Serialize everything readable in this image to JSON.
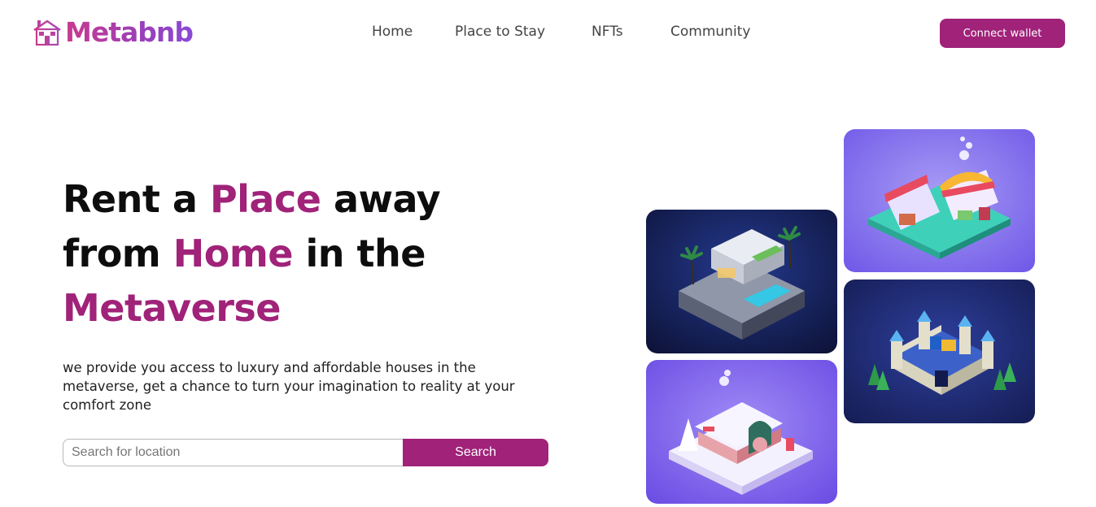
{
  "brand": {
    "name": "Metabnb",
    "icon": "house-icon"
  },
  "nav": {
    "links": [
      {
        "label": "Home"
      },
      {
        "label": "Place to Stay"
      },
      {
        "label": "NFTs"
      },
      {
        "label": "Community"
      }
    ],
    "cta_label": "Connect wallet"
  },
  "hero": {
    "title_part1": "Rent a ",
    "title_accent1": "Place",
    "title_part2": " away",
    "title_part3": "from ",
    "title_accent2": "Home",
    "title_part4": " in the",
    "title_accent3": "Metaverse",
    "subtitle": "we provide you access to luxury and affordable houses in the metaverse, get a chance to turn your imagination to reality at your comfort zone"
  },
  "search": {
    "placeholder": "Search for location",
    "value": "",
    "button_label": "Search"
  },
  "gallery": [
    {
      "name": "market-stall-image"
    },
    {
      "name": "modern-villa-image"
    },
    {
      "name": "castle-image"
    },
    {
      "name": "snow-cottage-image"
    }
  ],
  "colors": {
    "accent": "#a02279",
    "logo_gradient_start": "#c93a8e",
    "logo_gradient_end": "#8a4ad6",
    "text_dark": "#0d0d0d",
    "nav_text": "#434343"
  }
}
